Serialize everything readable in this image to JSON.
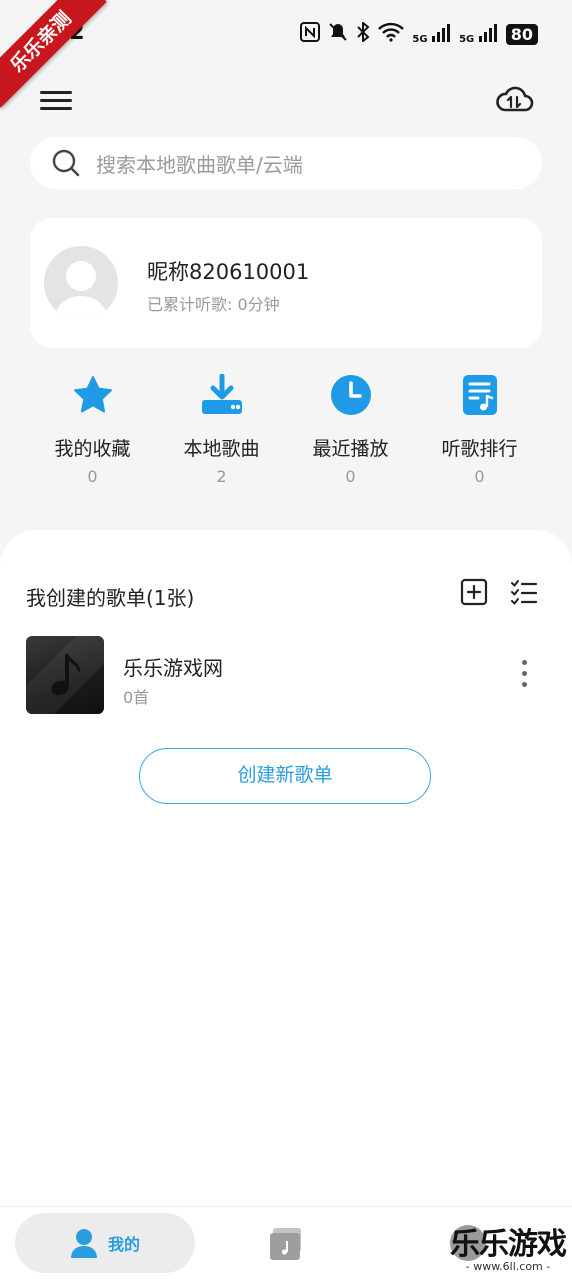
{
  "status_bar": {
    "time": "22",
    "net1": "5G",
    "net2": "5G",
    "battery": "80"
  },
  "ribbon": {
    "text": "乐乐亲测"
  },
  "header": {
    "menu_icon": "menu-icon",
    "cloud_icon": "cloud-sync-icon"
  },
  "search": {
    "placeholder": "搜索本地歌曲歌单/云端"
  },
  "profile": {
    "nickname": "昵称820610001",
    "listen_time": "已累计听歌: 0分钟"
  },
  "quick_actions": [
    {
      "icon": "star-icon",
      "label": "我的收藏",
      "count": "0"
    },
    {
      "icon": "download-icon",
      "label": "本地歌曲",
      "count": "2"
    },
    {
      "icon": "clock-icon",
      "label": "最近播放",
      "count": "0"
    },
    {
      "icon": "music-note-doc-icon",
      "label": "听歌排行",
      "count": "0"
    }
  ],
  "playlists_section": {
    "title": "我创建的歌单(1张)",
    "add_icon": "add-square-icon",
    "manage_icon": "checklist-icon",
    "items": [
      {
        "name": "乐乐游戏网",
        "count": "0首"
      }
    ],
    "create_button": "创建新歌单"
  },
  "bottom_nav": {
    "mine_label": "我的"
  },
  "watermark": {
    "title": "乐乐游戏",
    "sub": "- www.6ll.com -"
  },
  "colors": {
    "accent": "#2a9de0",
    "icon_blue": "#1e9ae6",
    "background": "#f5f5f5"
  }
}
